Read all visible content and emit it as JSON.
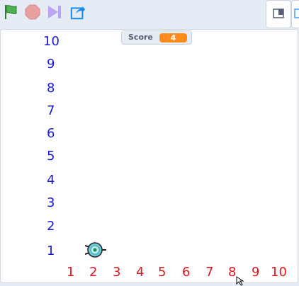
{
  "toolbar": {
    "icons": [
      "green-flag-icon",
      "stop-icon",
      "skip-icon",
      "share-icon"
    ]
  },
  "monitor": {
    "label": "Score",
    "value": "4"
  },
  "y_axis": [
    "10",
    "9",
    "8",
    "7",
    "6",
    "5",
    "4",
    "3",
    "2",
    "1"
  ],
  "x_axis": [
    "1",
    "2",
    "3",
    "4",
    "5",
    "6",
    "7",
    "8",
    "9",
    "10"
  ],
  "colors": {
    "y_numbers": "#1a1adb",
    "x_numbers": "#e0161c",
    "score_value": "#ff8c1a"
  }
}
